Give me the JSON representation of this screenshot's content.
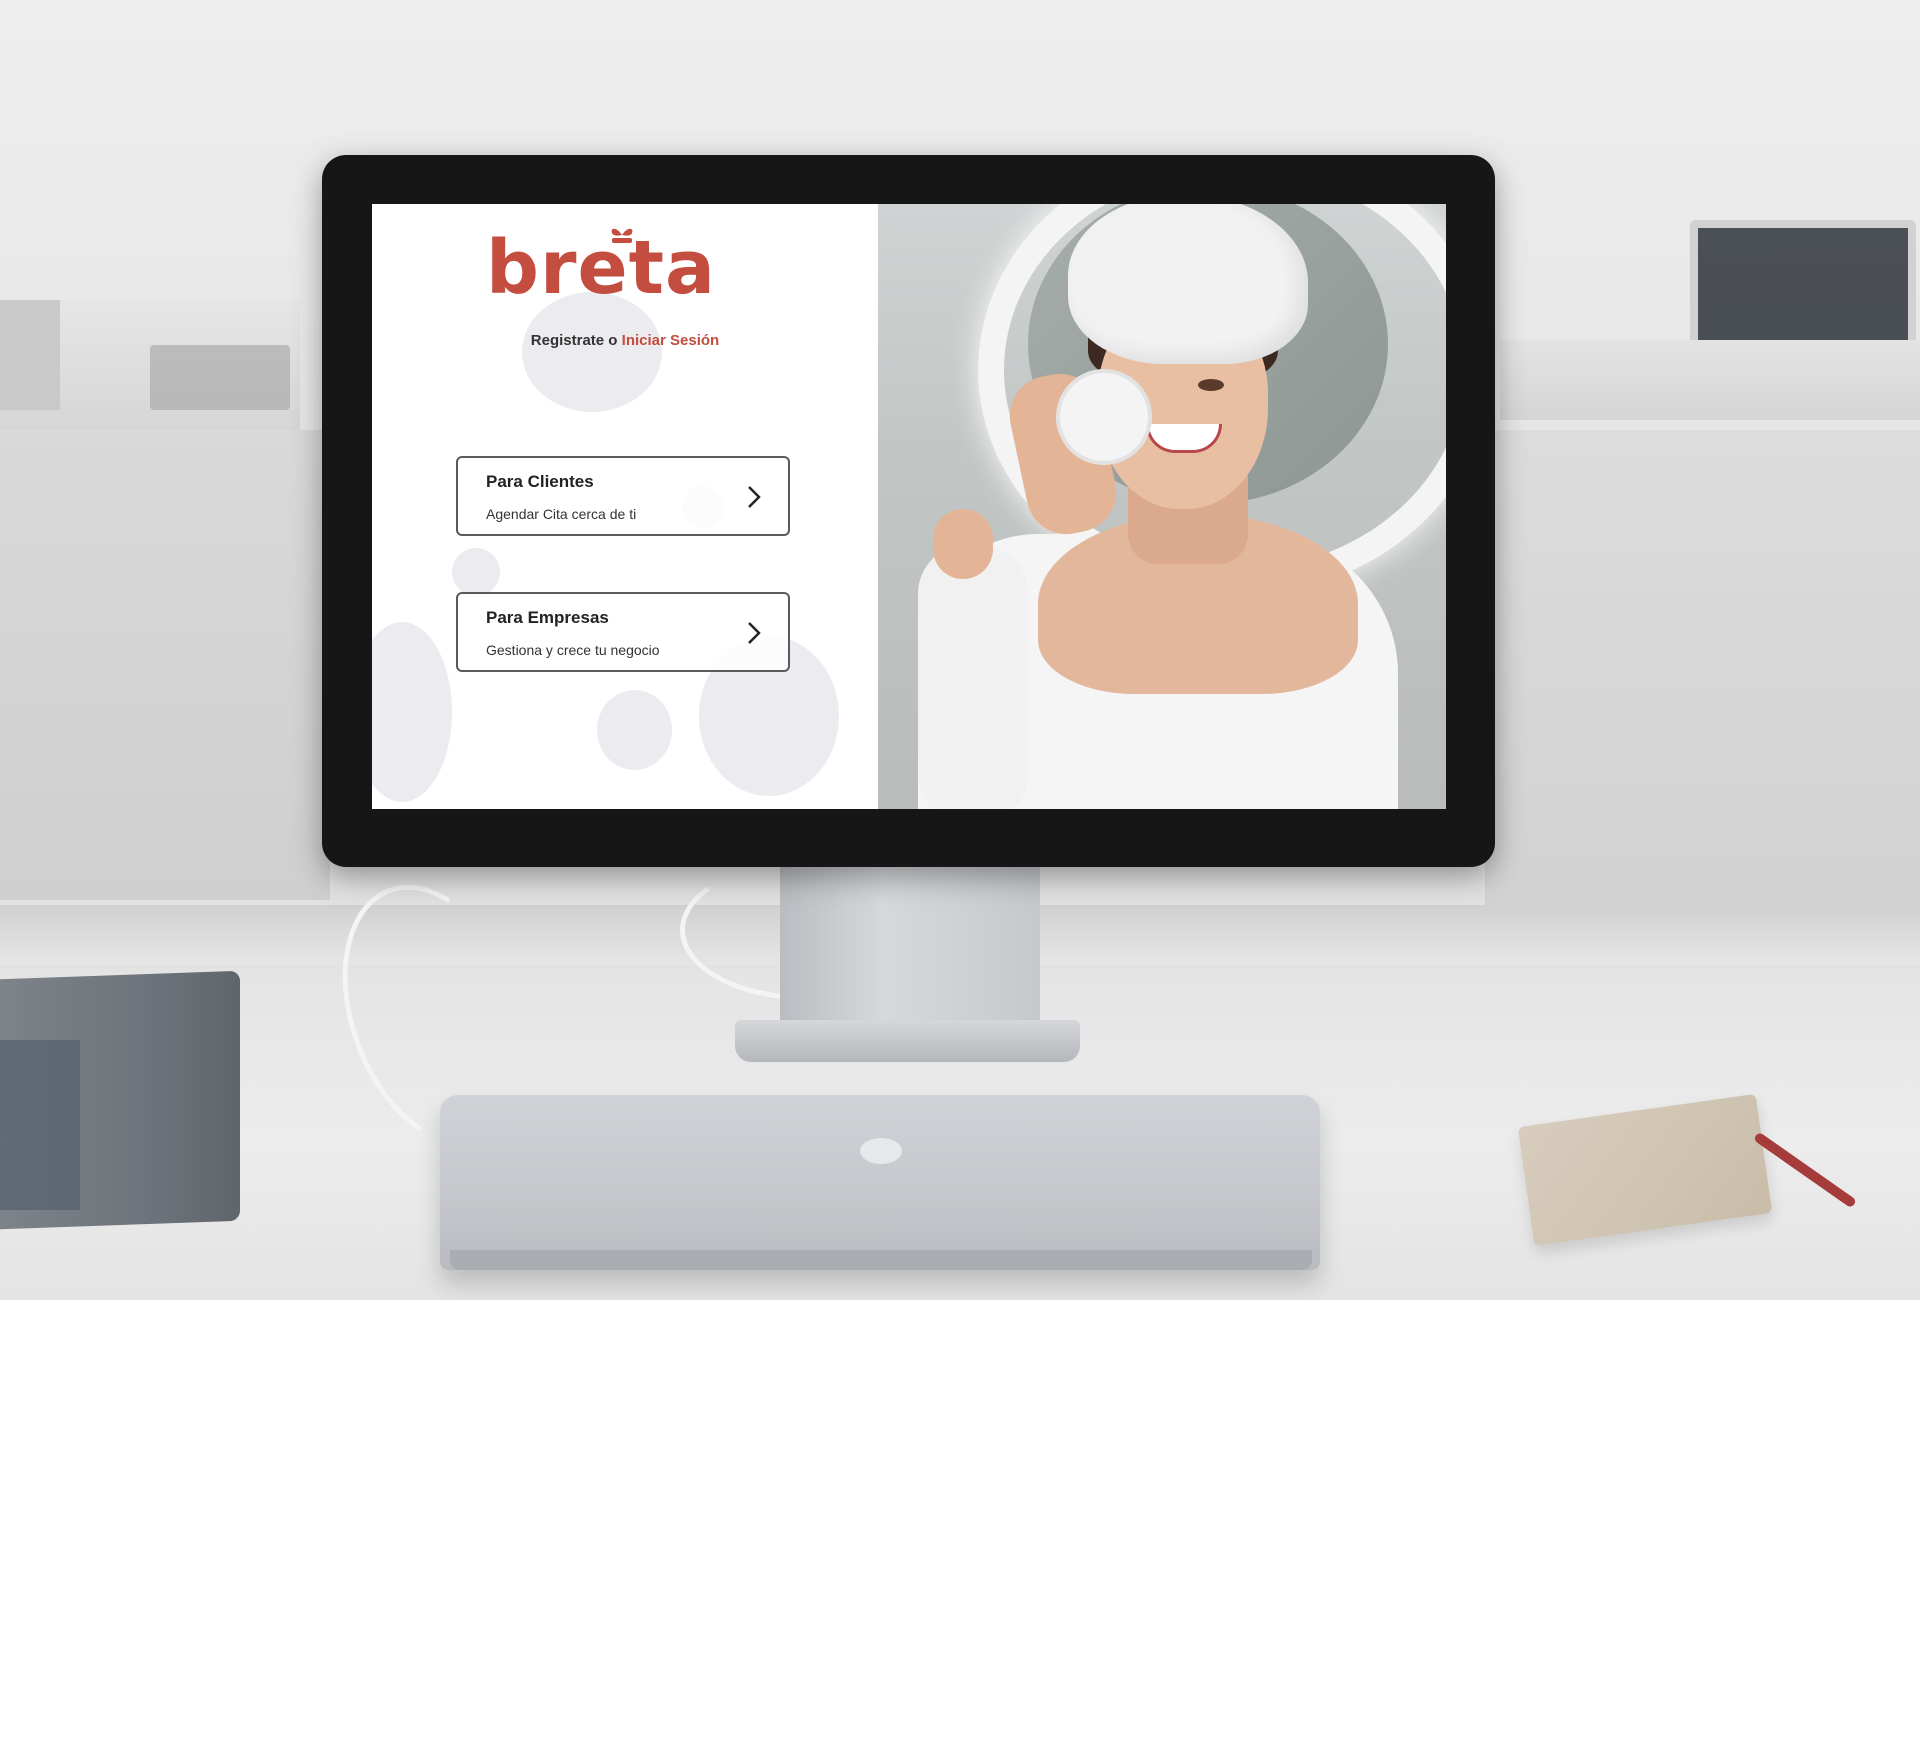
{
  "app": {
    "brand_name": "breta",
    "brand_color": "#c34d3f"
  },
  "auth": {
    "prefix": "Registrate o",
    "login_link": "Iniciar Sesión"
  },
  "options": [
    {
      "title": "Para Clientes",
      "subtitle": "Agendar Cita cerca de ti",
      "icon": "chevron-right-icon"
    },
    {
      "title": "Para Empresas",
      "subtitle": "Gestiona y crece tu negocio",
      "icon": "chevron-right-icon"
    }
  ],
  "hero": {
    "subject": "woman-with-towel-holding-cream-jar"
  }
}
